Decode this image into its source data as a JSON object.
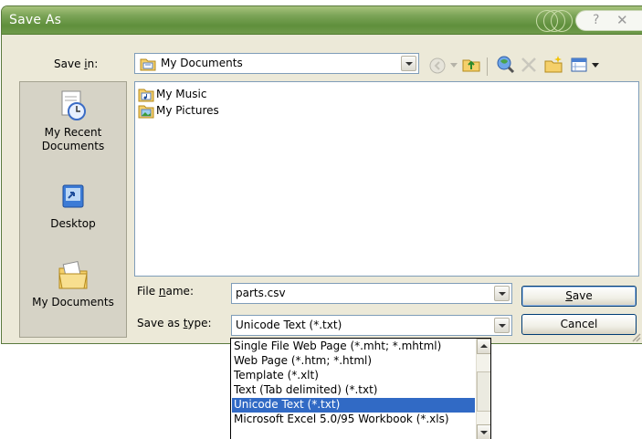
{
  "window": {
    "title": "Save As",
    "help_glyph": "?",
    "close_glyph": "✕"
  },
  "save_in": {
    "label_pre": "Save ",
    "label_key": "i",
    "label_post": "n:",
    "value": "My Documents"
  },
  "toolbar": {
    "icons": [
      "back-icon",
      "up-folder-icon",
      "search-web-icon",
      "delete-icon",
      "new-folder-icon",
      "views-icon"
    ]
  },
  "places": [
    {
      "label_line1": "My Recent",
      "label_line2": "Documents",
      "icon": "recent-documents-icon"
    },
    {
      "label_line1": "Desktop",
      "label_line2": "",
      "icon": "desktop-icon"
    },
    {
      "label_line1": "My Documents",
      "label_line2": "",
      "icon": "my-documents-icon"
    }
  ],
  "files": [
    {
      "name": "My Music",
      "icon": "music-folder-icon"
    },
    {
      "name": "My Pictures",
      "icon": "pictures-folder-icon"
    }
  ],
  "file_name": {
    "label_pre": "File ",
    "label_key": "n",
    "label_post": "ame:",
    "value": "parts.csv"
  },
  "save_type": {
    "label_pre": "Save as ",
    "label_key": "t",
    "label_post": "ype:",
    "value": "Unicode Text (*.txt)"
  },
  "buttons": {
    "save_key": "S",
    "save_rest": "ave",
    "cancel": "Cancel"
  },
  "type_options": [
    "Single File Web Page (*.mht; *.mhtml)",
    "Web Page (*.htm; *.html)",
    "Template (*.xlt)",
    "Text (Tab delimited) (*.txt)",
    "Unicode Text (*.txt)",
    "Microsoft Excel 5.0/95 Workbook (*.xls)"
  ],
  "selected_option_index": 4,
  "colors": {
    "titlebar": "#6f9a4a",
    "dialog_bg": "#ece9d8",
    "selection": "#316ac5"
  }
}
